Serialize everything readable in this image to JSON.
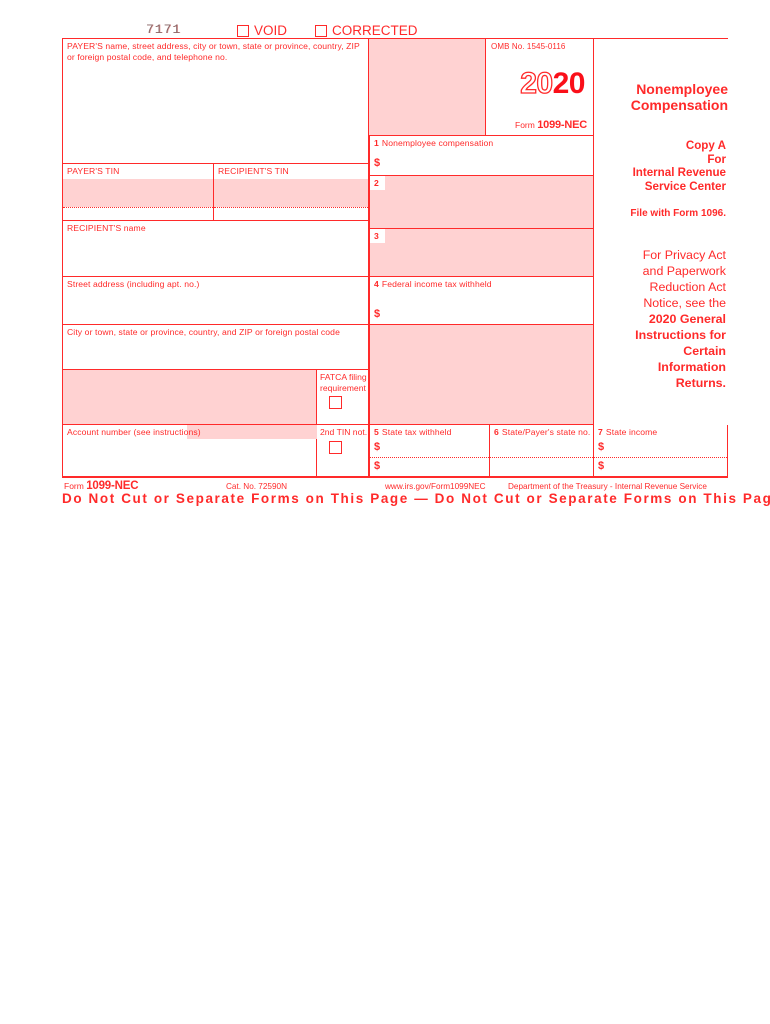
{
  "form": {
    "serial_number": "7171",
    "void_label": "VOID",
    "corrected_label": "CORRECTED",
    "omb_number": "OMB No. 1545-0116",
    "year_prefix": "20",
    "year_suffix": "20",
    "form_word": "Form",
    "form_number": "1099-NEC",
    "title_line1": "Nonemployee",
    "title_line2": "Compensation"
  },
  "payer": {
    "address_label_line1": "PAYER'S name, street address, city or town, state or province, country, ZIP",
    "address_label_line2": "or foreign postal code, and telephone no.",
    "tin_label": "PAYER'S TIN"
  },
  "recipient": {
    "tin_label": "RECIPIENT'S TIN",
    "name_label": "RECIPIENT'S name",
    "street_label": "Street address (including apt. no.)",
    "city_label": "City or town, state or province, country, and ZIP or foreign postal code",
    "account_label": "Account number (see instructions)"
  },
  "boxes": {
    "b1_num": "1",
    "b1_label": "Nonemployee compensation",
    "b1_dollar": "$",
    "b2_num": "2",
    "b3_num": "3",
    "b4_num": "4",
    "b4_label": "Federal income tax withheld",
    "b4_dollar": "$",
    "b5_num": "5",
    "b5_label": "State tax withheld",
    "b5_dollar_1": "$",
    "b5_dollar_2": "$",
    "b6_num": "6",
    "b6_label": "State/Payer's state no.",
    "b7_num": "7",
    "b7_label": "State income",
    "b7_dollar_1": "$",
    "b7_dollar_2": "$"
  },
  "flags": {
    "fatca_line1": "FATCA filing",
    "fatca_line2": "requirement",
    "second_tin_label": "2nd TIN not."
  },
  "copy": {
    "copy_a": "Copy A",
    "for": "For",
    "irs_line1": "Internal Revenue",
    "irs_line2": "Service Center",
    "file_with": "File with Form 1096.",
    "privacy_line1": "For Privacy Act",
    "privacy_line2": "and Paperwork",
    "privacy_line3": "Reduction Act",
    "privacy_line4": "Notice, see the",
    "privacy_bold1": "2020 General",
    "privacy_bold2": "Instructions for",
    "privacy_bold3": "Certain",
    "privacy_bold4": "Information",
    "privacy_bold5": "Returns."
  },
  "footer": {
    "form_word": "Form",
    "form_number": "1099-NEC",
    "cat_no": "Cat. No. 72590N",
    "url": "www.irs.gov/Form1099NEC",
    "department": "Department of the Treasury - Internal Revenue Service",
    "do_not_cut": "Do Not Cut or Separate Forms on This Page — Do Not Cut or Separate Forms on This Page"
  },
  "colors": {
    "red": "#ff2a2a",
    "red_strong": "#fa0f19",
    "pink": "#ffd2d2"
  }
}
